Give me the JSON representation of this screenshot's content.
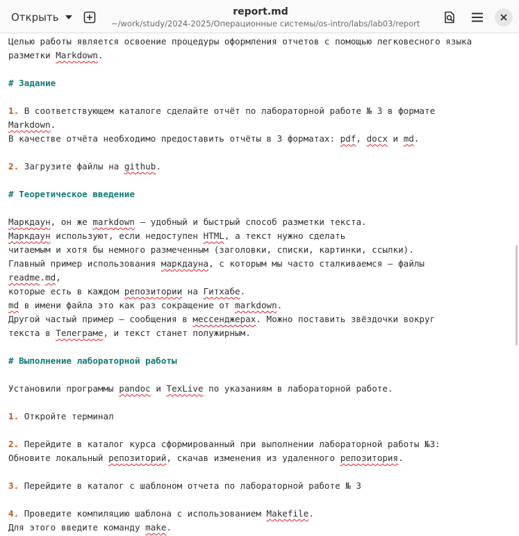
{
  "header": {
    "open_label": "Открыть",
    "title": "report.md",
    "subtitle": "~/work/study/2024-2025/Операционные системы/os-intro/labs/lab03/report"
  },
  "icons": {
    "new_tab": "new-tab-icon",
    "search": "search-document-icon",
    "menu": "hamburger-menu-icon",
    "close": "close-icon"
  },
  "colors": {
    "heading": "#127a7a",
    "list_number": "#c5541b",
    "spellcheck": "#e01b24",
    "text": "#2e2e2e"
  },
  "editor": {
    "lines": [
      [
        {
          "t": "Целью работы является освоение процедуры оформления отчетов с помощью легковесного языка"
        }
      ],
      [
        {
          "t": "разметки "
        },
        {
          "t": "Markdown",
          "c": "sp"
        },
        {
          "t": "."
        }
      ],
      [],
      [
        {
          "t": "# Задание",
          "c": "heading"
        }
      ],
      [],
      [
        {
          "t": "1.",
          "c": "num"
        },
        {
          "t": " В соответствующем каталоге сделайте отчёт по лабораторной работе № 3 в формате"
        }
      ],
      [
        {
          "t": "Markdown",
          "c": "sp"
        },
        {
          "t": "."
        }
      ],
      [
        {
          "t": "В качестве отчёта необходимо предоставить отчёты в 3 форматах: "
        },
        {
          "t": "pdf",
          "c": "sp"
        },
        {
          "t": ", "
        },
        {
          "t": "docx",
          "c": "sp"
        },
        {
          "t": " и "
        },
        {
          "t": "md",
          "c": "sp"
        },
        {
          "t": "."
        }
      ],
      [],
      [
        {
          "t": "2.",
          "c": "num"
        },
        {
          "t": " Загрузите файлы на "
        },
        {
          "t": "github",
          "c": "sp"
        },
        {
          "t": "."
        }
      ],
      [],
      [
        {
          "t": "# Теоретическое введение",
          "c": "heading"
        }
      ],
      [],
      [
        {
          "t": "Маркдаун",
          "c": "sp"
        },
        {
          "t": ", он же "
        },
        {
          "t": "markdown",
          "c": "sp"
        },
        {
          "t": " — удобный и быстрый способ разметки текста."
        }
      ],
      [
        {
          "t": "Маркдаун",
          "c": "sp"
        },
        {
          "t": " используют, если недоступен "
        },
        {
          "t": "HTML",
          "c": "sp"
        },
        {
          "t": ", а текст нужно сделать"
        }
      ],
      [
        {
          "t": "читаемым и хотя бы немного размеченным (заголовки, списки, картинки, ссылки)."
        }
      ],
      [
        {
          "t": "Главный пример использования "
        },
        {
          "t": "маркдауна",
          "c": "sp"
        },
        {
          "t": ", с которым мы часто сталкиваемся — файлы"
        }
      ],
      [
        {
          "t": "readme",
          "c": "sp"
        },
        {
          "t": "."
        },
        {
          "t": "md",
          "c": "sp"
        },
        {
          "t": ","
        }
      ],
      [
        {
          "t": "которые есть в каждом "
        },
        {
          "t": "репозитории",
          "c": "sp"
        },
        {
          "t": " на "
        },
        {
          "t": "Гитхабе",
          "c": "sp"
        },
        {
          "t": "."
        }
      ],
      [
        {
          "t": "md",
          "c": "sp"
        },
        {
          "t": " в имени файла это как раз сокращение от "
        },
        {
          "t": "markdown",
          "c": "sp"
        },
        {
          "t": "."
        }
      ],
      [
        {
          "t": "Другой частый пример — сообщения в "
        },
        {
          "t": "мессенджерах",
          "c": "sp"
        },
        {
          "t": ". Можно поставить звёздочки вокруг"
        }
      ],
      [
        {
          "t": "текста в "
        },
        {
          "t": "Телеграме",
          "c": "sp"
        },
        {
          "t": ", и текст станет полужирным."
        }
      ],
      [],
      [
        {
          "t": "# Выполнение лабораторной работы",
          "c": "heading"
        }
      ],
      [],
      [
        {
          "t": "Установили программы "
        },
        {
          "t": "pandoc",
          "c": "sp"
        },
        {
          "t": " и "
        },
        {
          "t": "TexLive",
          "c": "sp"
        },
        {
          "t": " по указаниям в лабораторной работе."
        }
      ],
      [],
      [
        {
          "t": "1.",
          "c": "num"
        },
        {
          "t": " Откройте терминал"
        }
      ],
      [],
      [
        {
          "t": "2.",
          "c": "num"
        },
        {
          "t": " Перейдите в каталог курса сформированный при выполнении лабораторной работы №3:"
        }
      ],
      [
        {
          "t": "Обновите локальный "
        },
        {
          "t": "репозиторий",
          "c": "sp"
        },
        {
          "t": ", скачав изменения из удаленного "
        },
        {
          "t": "репозитория",
          "c": "sp"
        },
        {
          "t": "."
        }
      ],
      [],
      [
        {
          "t": "3.",
          "c": "num"
        },
        {
          "t": " Перейдите в каталог с шаблоном отчета по лабораторной работе № 3"
        }
      ],
      [],
      [
        {
          "t": "4.",
          "c": "num"
        },
        {
          "t": " Проведите компиляцию шаблона с использованием "
        },
        {
          "t": "Makefile",
          "c": "sp"
        },
        {
          "t": "."
        }
      ],
      [
        {
          "t": "Для этого введите команду "
        },
        {
          "t": "make",
          "c": "sp"
        },
        {
          "t": "."
        }
      ]
    ]
  }
}
